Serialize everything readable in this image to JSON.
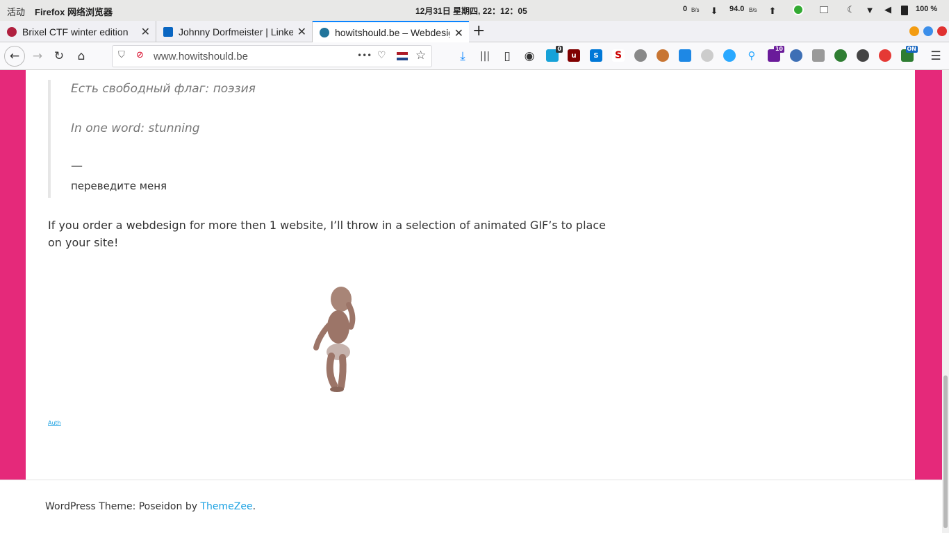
{
  "system_bar": {
    "activities": "活动",
    "app_name": "Firefox 网络浏览器",
    "clock": "12月31日 星期四, 22：12：05",
    "net_down_value": "0",
    "net_down_unit": "B/s",
    "net_up_value": "94.0",
    "net_up_unit": "B/s",
    "battery": "100 %"
  },
  "tabs": [
    {
      "title": "Brixel CTF winter edition",
      "favicon": "brixel-icon",
      "active": false
    },
    {
      "title": "Johnny Dorfmeister | LinkedIn",
      "favicon": "linkedin-icon",
      "active": false
    },
    {
      "title": "howitshould.be – Webdesign",
      "favicon": "wordpress-icon",
      "active": true
    }
  ],
  "new_tab_symbol": "+",
  "urlbar": {
    "url": "www.howitshould.be",
    "more": "•••"
  },
  "extensions": {
    "badge_ghostery": "0",
    "badge_purple": "10",
    "badge_on": "ON"
  },
  "page": {
    "quote_lines": [
      "Есть свободный флаг: поэзия",
      "In one word: stunning"
    ],
    "quote_dash": "—",
    "quote_cite": "переведите меня",
    "paragraph_line1": "If you order a webdesign for more then 1 website, I’ll throw in a selection of animated GIF’s to place",
    "paragraph_line2": "on your site!",
    "auth_link": "Auth"
  },
  "footer": {
    "prefix": "WordPress Theme: Poseidon by ",
    "link": "ThemeZee",
    "suffix": "."
  },
  "colors": {
    "accent_pink": "#e5297a",
    "link_blue": "#1ba1e2",
    "tab_active_blue": "#0a84ff"
  }
}
